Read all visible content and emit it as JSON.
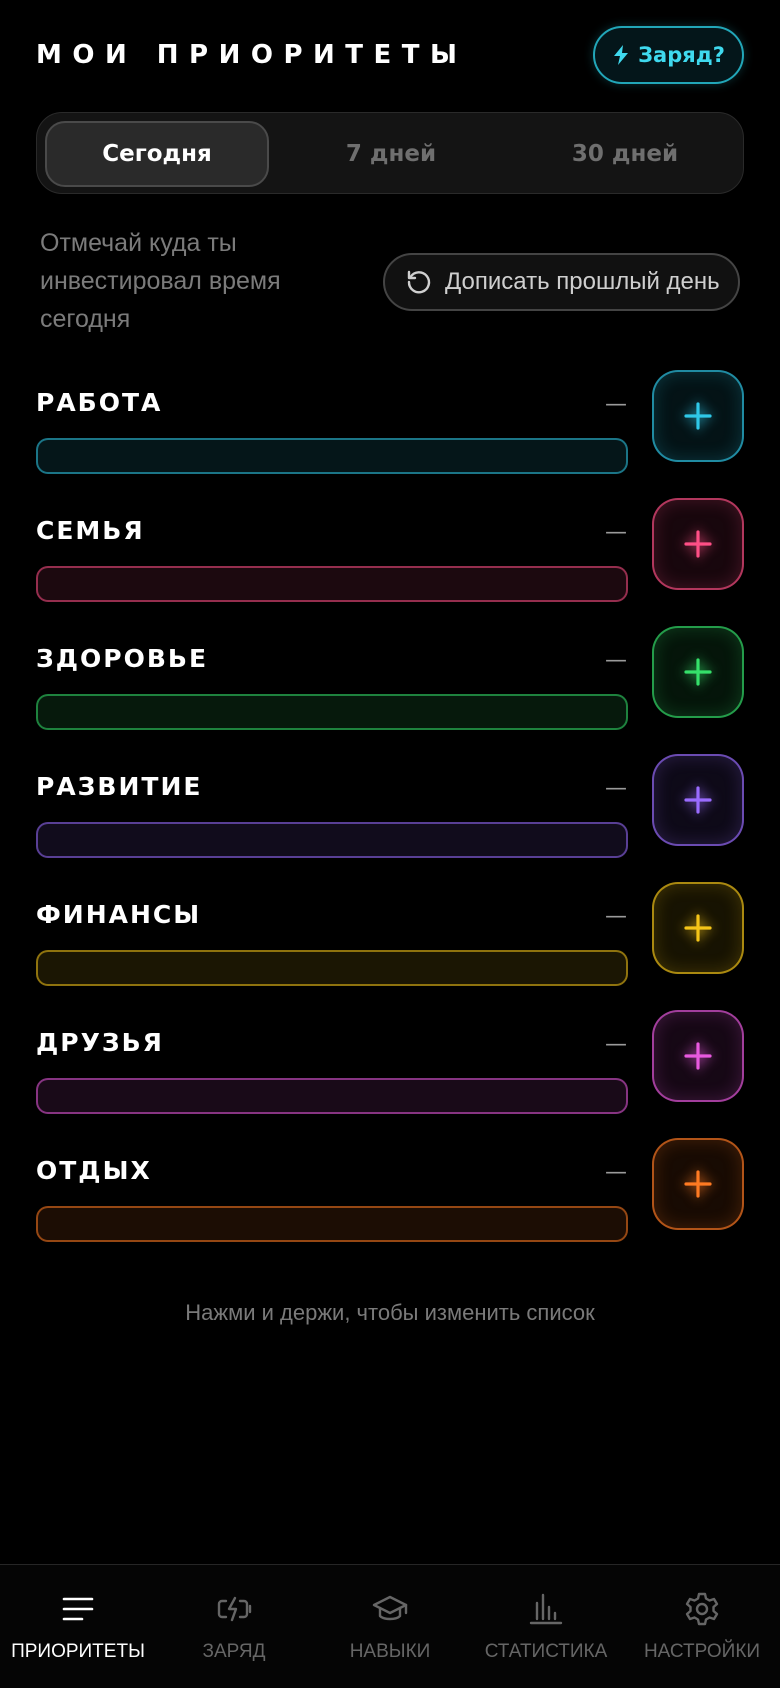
{
  "header": {
    "title": "МОИ ПРИОРИТЕТЫ",
    "charge_button": "Заряд?",
    "charge_color": "#3fd9ee"
  },
  "tabs": [
    {
      "label": "Сегодня",
      "active": true
    },
    {
      "label": "7 дней",
      "active": false
    },
    {
      "label": "30 дней",
      "active": false
    }
  ],
  "hint": "Отмечай куда ты инвестировал время сегодня",
  "backfill_button": "Дописать прошлый день",
  "categories": [
    {
      "name": "РАБОТА",
      "value": "—",
      "color": "#2fc8e8",
      "progress": 0
    },
    {
      "name": "СЕМЬЯ",
      "value": "—",
      "color": "#ff4f86",
      "progress": 0
    },
    {
      "name": "ЗДОРОВЬЕ",
      "value": "—",
      "color": "#35e06a",
      "progress": 0
    },
    {
      "name": "РАЗВИТИЕ",
      "value": "—",
      "color": "#9a6cff",
      "progress": 0
    },
    {
      "name": "ФИНАНСЫ",
      "value": "—",
      "color": "#f5c518",
      "progress": 0
    },
    {
      "name": "ДРУЗЬЯ",
      "value": "—",
      "color": "#e85adf",
      "progress": 0
    },
    {
      "name": "ОТДЫХ",
      "value": "—",
      "color": "#ff7a22",
      "progress": 0
    }
  ],
  "footer_hint": "Нажми и держи, чтобы изменить список",
  "nav": [
    {
      "label": "ПРИОРИТЕТЫ",
      "icon": "list-icon",
      "active": true
    },
    {
      "label": "ЗАРЯД",
      "icon": "battery-charge-icon",
      "active": false
    },
    {
      "label": "НАВЫКИ",
      "icon": "graduation-cap-icon",
      "active": false
    },
    {
      "label": "СТАТИСТИКА",
      "icon": "bar-chart-icon",
      "active": false
    },
    {
      "label": "НАСТРОЙКИ",
      "icon": "gear-icon",
      "active": false
    }
  ]
}
